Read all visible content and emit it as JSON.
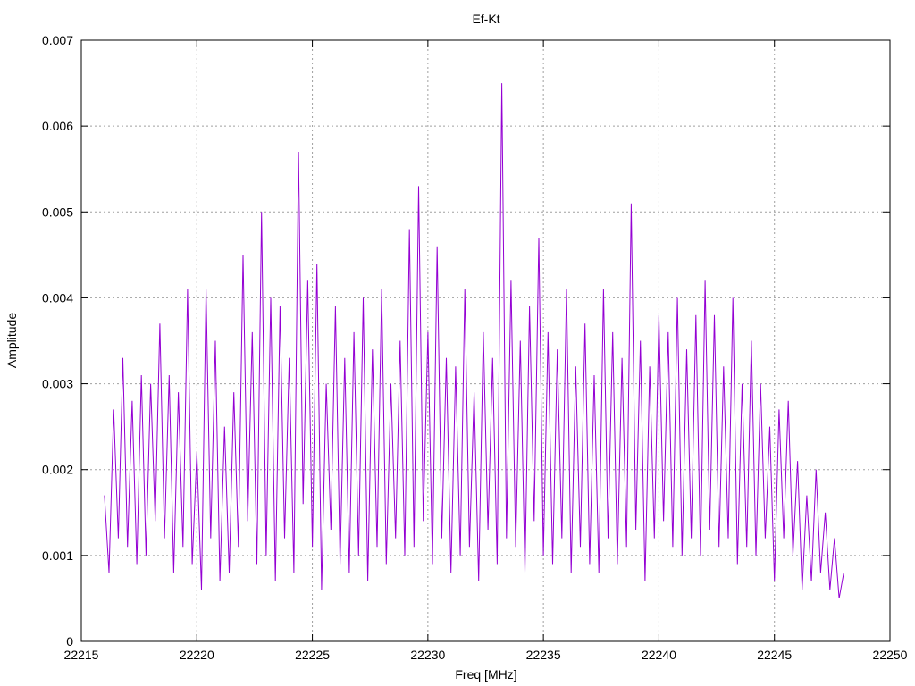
{
  "chart_data": {
    "type": "line",
    "title": "Ef-Kt",
    "xlabel": "Freq [MHz]",
    "ylabel": "Amplitude",
    "xlim": [
      22215,
      22250
    ],
    "ylim": [
      0,
      0.007
    ],
    "xticks": [
      22215,
      22220,
      22225,
      22230,
      22235,
      22240,
      22245,
      22250
    ],
    "xtick_labels": [
      "22215",
      "22220",
      "22225",
      "22230",
      "22235",
      "22240",
      "22245",
      "22250"
    ],
    "yticks": [
      0,
      0.001,
      0.002,
      0.003,
      0.004,
      0.005,
      0.006,
      0.007
    ],
    "ytick_labels": [
      "0",
      "0.001",
      "0.002",
      "0.003",
      "0.004",
      "0.005",
      "0.006",
      "0.007"
    ],
    "grid": true,
    "legend": "none",
    "series": [
      {
        "color": "#9400d3",
        "x": [
          22216.0,
          22216.2,
          22216.4,
          22216.6,
          22216.8,
          22217.0,
          22217.2,
          22217.4,
          22217.6,
          22217.8,
          22218.0,
          22218.2,
          22218.4,
          22218.6,
          22218.8,
          22219.0,
          22219.2,
          22219.4,
          22219.6,
          22219.8,
          22220.0,
          22220.2,
          22220.4,
          22220.6,
          22220.8,
          22221.0,
          22221.2,
          22221.4,
          22221.6,
          22221.8,
          22222.0,
          22222.2,
          22222.4,
          22222.6,
          22222.8,
          22223.0,
          22223.2,
          22223.4,
          22223.6,
          22223.8,
          22224.0,
          22224.2,
          22224.4,
          22224.6,
          22224.8,
          22225.0,
          22225.2,
          22225.4,
          22225.6,
          22225.8,
          22226.0,
          22226.2,
          22226.4,
          22226.6,
          22226.8,
          22227.0,
          22227.2,
          22227.4,
          22227.6,
          22227.8,
          22228.0,
          22228.2,
          22228.4,
          22228.6,
          22228.8,
          22229.0,
          22229.2,
          22229.4,
          22229.6,
          22229.8,
          22230.0,
          22230.2,
          22230.4,
          22230.6,
          22230.8,
          22231.0,
          22231.2,
          22231.4,
          22231.6,
          22231.8,
          22232.0,
          22232.2,
          22232.4,
          22232.6,
          22232.8,
          22233.0,
          22233.2,
          22233.4,
          22233.6,
          22233.8,
          22234.0,
          22234.2,
          22234.4,
          22234.6,
          22234.8,
          22235.0,
          22235.2,
          22235.4,
          22235.6,
          22235.8,
          22236.0,
          22236.2,
          22236.4,
          22236.6,
          22236.8,
          22237.0,
          22237.2,
          22237.4,
          22237.6,
          22237.8,
          22238.0,
          22238.2,
          22238.4,
          22238.6,
          22238.8,
          22239.0,
          22239.2,
          22239.4,
          22239.6,
          22239.8,
          22240.0,
          22240.2,
          22240.4,
          22240.6,
          22240.8,
          22241.0,
          22241.2,
          22241.4,
          22241.6,
          22241.8,
          22242.0,
          22242.2,
          22242.4,
          22242.6,
          22242.8,
          22243.0,
          22243.2,
          22243.4,
          22243.6,
          22243.8,
          22244.0,
          22244.2,
          22244.4,
          22244.6,
          22244.8,
          22245.0,
          22245.2,
          22245.4,
          22245.6,
          22245.8,
          22246.0,
          22246.2,
          22246.4,
          22246.6,
          22246.8,
          22247.0,
          22247.2,
          22247.4,
          22247.6,
          22247.8,
          22248.0
        ],
        "y": [
          0.0017,
          0.0008,
          0.0027,
          0.0012,
          0.0033,
          0.0011,
          0.0028,
          0.0009,
          0.0031,
          0.001,
          0.003,
          0.0014,
          0.0037,
          0.0012,
          0.0031,
          0.0008,
          0.0029,
          0.0011,
          0.0041,
          0.0009,
          0.0022,
          0.0006,
          0.0041,
          0.0012,
          0.0035,
          0.0007,
          0.0025,
          0.0008,
          0.0029,
          0.0011,
          0.0045,
          0.0014,
          0.0036,
          0.0009,
          0.005,
          0.001,
          0.004,
          0.0007,
          0.0039,
          0.0012,
          0.0033,
          0.0008,
          0.0057,
          0.0016,
          0.0042,
          0.0011,
          0.0044,
          0.0006,
          0.003,
          0.0013,
          0.0039,
          0.0009,
          0.0033,
          0.0008,
          0.0036,
          0.001,
          0.004,
          0.0007,
          0.0034,
          0.0011,
          0.0041,
          0.0009,
          0.003,
          0.0012,
          0.0035,
          0.001,
          0.0048,
          0.0011,
          0.0053,
          0.0014,
          0.0036,
          0.0009,
          0.0046,
          0.0012,
          0.0033,
          0.0008,
          0.0032,
          0.001,
          0.0041,
          0.0011,
          0.0029,
          0.0007,
          0.0036,
          0.0013,
          0.0033,
          0.0009,
          0.0065,
          0.0012,
          0.0042,
          0.0011,
          0.0035,
          0.0008,
          0.0039,
          0.0014,
          0.0047,
          0.001,
          0.0036,
          0.0009,
          0.0034,
          0.0012,
          0.0041,
          0.0008,
          0.0032,
          0.0011,
          0.0037,
          0.0009,
          0.0031,
          0.0008,
          0.0041,
          0.0012,
          0.0036,
          0.0009,
          0.0033,
          0.0011,
          0.0051,
          0.0013,
          0.0035,
          0.0007,
          0.0032,
          0.0012,
          0.0038,
          0.0014,
          0.0036,
          0.0011,
          0.004,
          0.001,
          0.0034,
          0.0012,
          0.0038,
          0.001,
          0.0042,
          0.0013,
          0.0038,
          0.0011,
          0.0032,
          0.0012,
          0.004,
          0.0009,
          0.003,
          0.0011,
          0.0035,
          0.001,
          0.003,
          0.0012,
          0.0025,
          0.0007,
          0.0027,
          0.0012,
          0.0028,
          0.001,
          0.0021,
          0.0006,
          0.0017,
          0.0007,
          0.002,
          0.0008,
          0.0015,
          0.0006,
          0.0012,
          0.0005,
          0.0008
        ]
      }
    ]
  }
}
